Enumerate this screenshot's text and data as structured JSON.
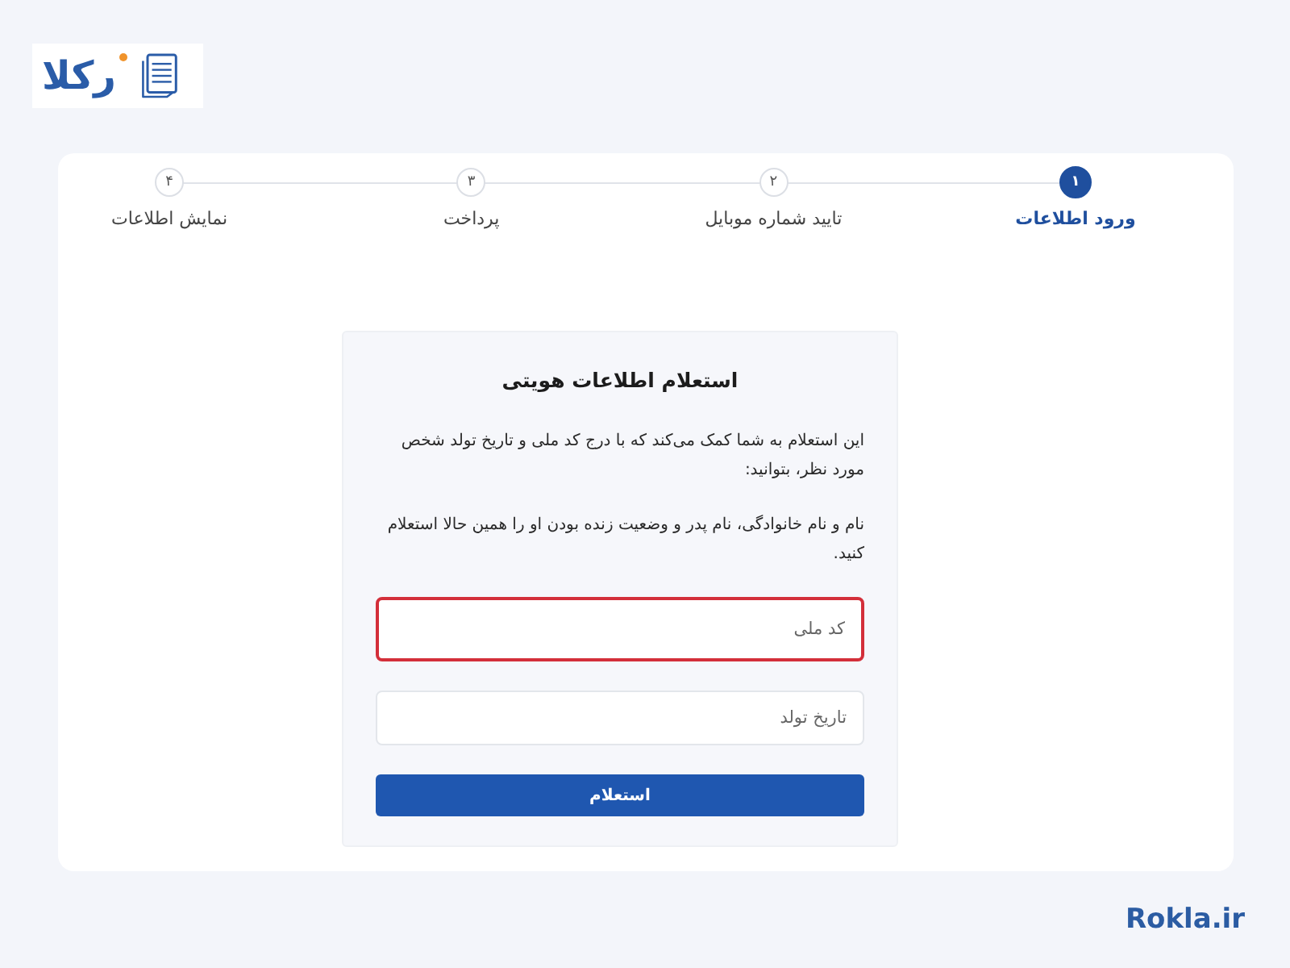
{
  "logo": {
    "text": "رکلا"
  },
  "steps": [
    {
      "number": "۱",
      "label": "ورود اطلاعات",
      "selected": true
    },
    {
      "number": "۲",
      "label": "تایید شماره موبایل",
      "selected": false
    },
    {
      "number": "۳",
      "label": "پرداخت",
      "selected": false
    },
    {
      "number": "۴",
      "label": "نمایش اطلاعات",
      "selected": false
    }
  ],
  "form": {
    "title": "استعلام اطلاعات هویتی",
    "paragraphs": [
      "این استعلام به شما کمک می‌کند که با درج کد ملی و تاریخ تولد شخص مورد نظر، بتوانید:",
      "نام و نام خانوادگی، نام پدر و وضعیت زنده بودن او را همین حالا استعلام کنید."
    ],
    "fields": [
      {
        "placeholder": "کد ملی",
        "error": true
      },
      {
        "placeholder": "تاریخ تولد",
        "error": false
      }
    ],
    "submit_button": "استعلام"
  },
  "footer": {
    "site": "Rokla.ir"
  }
}
